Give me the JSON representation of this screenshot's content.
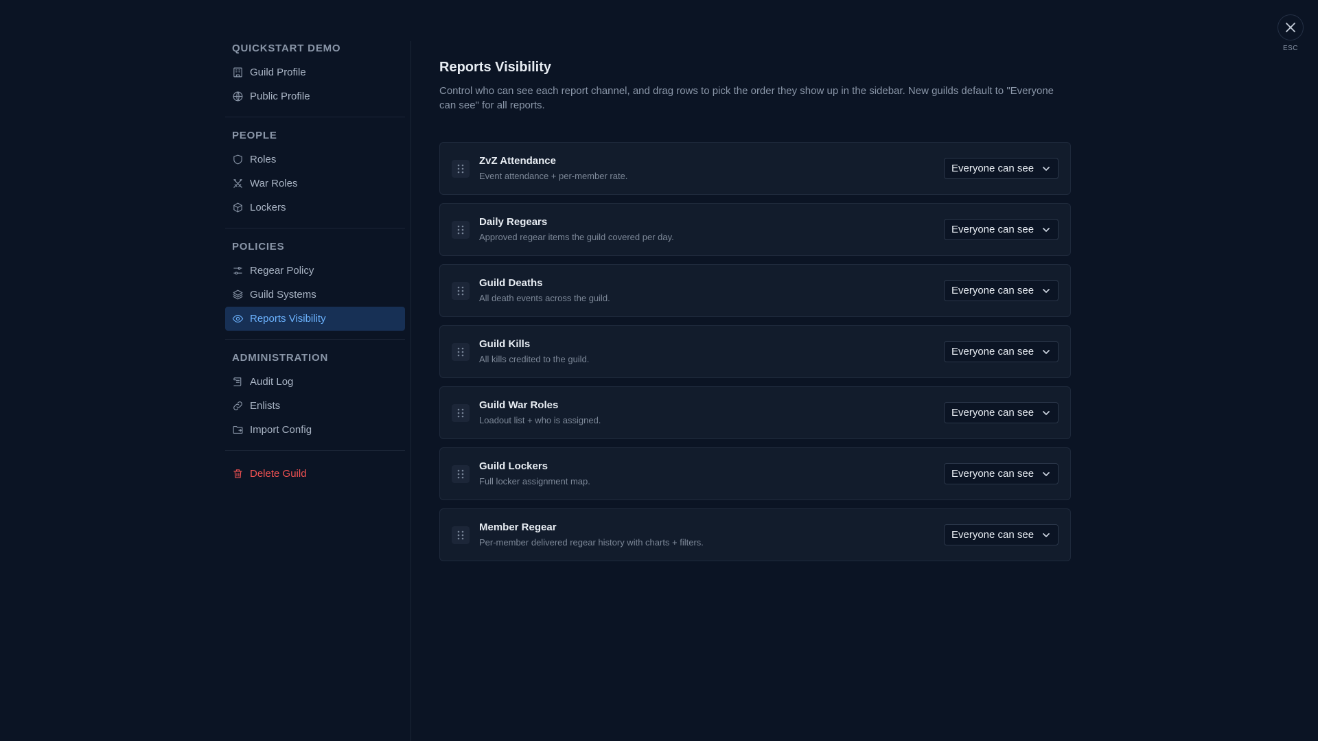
{
  "sidebar": {
    "sections": [
      {
        "title": "QUICKSTART DEMO",
        "items": [
          {
            "label": "Guild Profile",
            "icon": "building-icon"
          },
          {
            "label": "Public Profile",
            "icon": "globe-icon"
          }
        ]
      },
      {
        "title": "PEOPLE",
        "items": [
          {
            "label": "Roles",
            "icon": "shield-icon"
          },
          {
            "label": "War Roles",
            "icon": "crossed-swords-icon"
          },
          {
            "label": "Lockers",
            "icon": "box-icon"
          }
        ]
      },
      {
        "title": "POLICIES",
        "items": [
          {
            "label": "Regear Policy",
            "icon": "sliders-icon"
          },
          {
            "label": "Guild Systems",
            "icon": "layers-icon"
          },
          {
            "label": "Reports Visibility",
            "icon": "eye-icon",
            "active": true
          }
        ]
      },
      {
        "title": "ADMINISTRATION",
        "items": [
          {
            "label": "Audit Log",
            "icon": "scroll-icon"
          },
          {
            "label": "Enlists",
            "icon": "link-icon"
          },
          {
            "label": "Import Config",
            "icon": "folder-icon"
          }
        ]
      }
    ],
    "danger_item": {
      "label": "Delete Guild",
      "icon": "trash-icon",
      "color": "#f05252"
    }
  },
  "main": {
    "title": "Reports Visibility",
    "description": "Control who can see each report channel, and drag rows to pick the order they show up in the sidebar. New guilds default to \"Everyone can see\" for all reports.",
    "reports": [
      {
        "title": "ZvZ Attendance",
        "desc": "Event attendance + per-member rate.",
        "visibility": "Everyone can see"
      },
      {
        "title": "Daily Regears",
        "desc": "Approved regear items the guild covered per day.",
        "visibility": "Everyone can see"
      },
      {
        "title": "Guild Deaths",
        "desc": "All death events across the guild.",
        "visibility": "Everyone can see"
      },
      {
        "title": "Guild Kills",
        "desc": "All kills credited to the guild.",
        "visibility": "Everyone can see"
      },
      {
        "title": "Guild War Roles",
        "desc": "Loadout list + who is assigned.",
        "visibility": "Everyone can see"
      },
      {
        "title": "Guild Lockers",
        "desc": "Full locker assignment map.",
        "visibility": "Everyone can see"
      },
      {
        "title": "Member Regear",
        "desc": "Per-member delivered regear history with charts + filters.",
        "visibility": "Everyone can see"
      }
    ]
  },
  "close": {
    "esc_label": "ESC",
    "icon": "close-icon"
  },
  "colors": {
    "accent": "#6cb3ff",
    "active_bg": "#173055",
    "danger": "#f05252",
    "background": "#0b1424"
  }
}
